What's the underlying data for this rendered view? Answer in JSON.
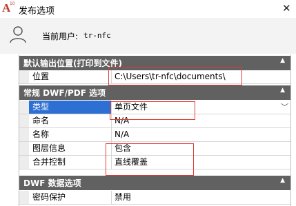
{
  "window": {
    "title": "发布选项"
  },
  "user": {
    "label": "当前用户:",
    "name": "tr-nfc"
  },
  "groups": [
    {
      "title": "默认输出位置(打印到文件)"
    },
    {
      "title": "常规 DWF/PDF 选项"
    },
    {
      "title": "DWF 数据选项"
    }
  ],
  "rows": {
    "location": {
      "label": "位置",
      "value": "C:\\Users\\tr-nfc\\documents\\"
    },
    "type": {
      "label": "类型",
      "value": "单页文件"
    },
    "naming": {
      "label": "命名",
      "value": "N/A"
    },
    "name": {
      "label": "名称",
      "value": "N/A"
    },
    "layer_info": {
      "label": "图层信息",
      "value": "包含"
    },
    "merge_control": {
      "label": "合并控制",
      "value": "直线覆盖"
    },
    "password": {
      "label": "密码保护",
      "value": "禁用"
    }
  },
  "colors": {
    "group_header": "#616161",
    "selection": "#2d6fd2",
    "highlight_box": "#e53935"
  },
  "icons": {
    "app": "autocad-icon",
    "user": "user-icon",
    "close": "close-icon",
    "collapse": "collapse-arrow-icon",
    "dropdown": "chevron-down-icon"
  }
}
